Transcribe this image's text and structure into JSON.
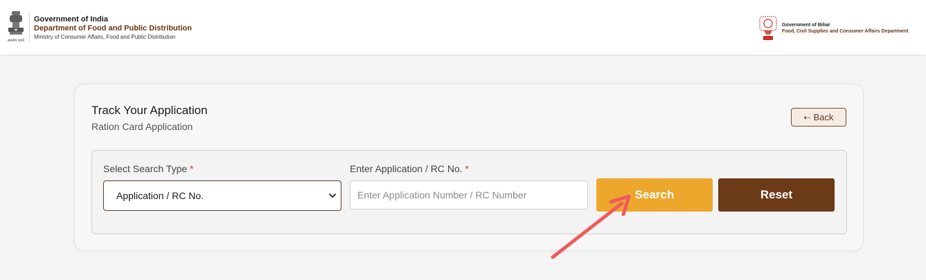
{
  "header": {
    "left": {
      "line1": "Government of India",
      "line2": "Department of Food and Public Distribution",
      "line3": "Ministry of Consumer Affairs, Food and Public Distribution"
    },
    "right": {
      "line1": "Government of Bihar",
      "line2": "Food, Civil Supplies and Consumer Affairs Department"
    }
  },
  "card": {
    "title": "Track Your Application",
    "subtitle": "Ration Card Application",
    "back_label": "Back"
  },
  "form": {
    "search_type": {
      "label": "Select Search Type",
      "required_mark": "*",
      "selected": "Application / RC No."
    },
    "application_no": {
      "label": "Enter Application / RC No.",
      "required_mark": "*",
      "value": "",
      "placeholder": "Enter Application Number / RC Number"
    },
    "search_label": "Search",
    "reset_label": "Reset"
  },
  "colors": {
    "brown_accent": "#6b3a17",
    "search_orange": "#eca72c",
    "annotation_red": "#f05a5a",
    "required_red": "#d23b3b"
  },
  "icons": [
    "national-emblem-icon",
    "bihar-emblem-icon",
    "back-arrow-icon",
    "chevron-down-icon",
    "annotation-arrow-icon"
  ]
}
